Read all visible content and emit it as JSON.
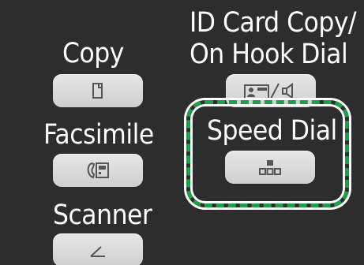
{
  "functions": {
    "copy": {
      "label": "Copy",
      "icon": "document-copy-icon"
    },
    "facsimile": {
      "label": "Facsimile",
      "icon": "fax-icon"
    },
    "scanner": {
      "label": "Scanner",
      "icon": "scanner-icon"
    },
    "id_card_copy": {
      "label_line1": "ID Card Copy/",
      "label_line2": "On Hook Dial",
      "icon": "id-card-on-hook-dial-icon"
    },
    "speed_dial": {
      "label": "Speed Dial",
      "icon": "speed-dial-icon"
    }
  },
  "highlight": {
    "target": "speed_dial",
    "color": "#1e9e47"
  },
  "colors": {
    "background": "#2d2d2d",
    "button": "#dcdcdc",
    "icon": "#555555",
    "text": "#ffffff"
  }
}
